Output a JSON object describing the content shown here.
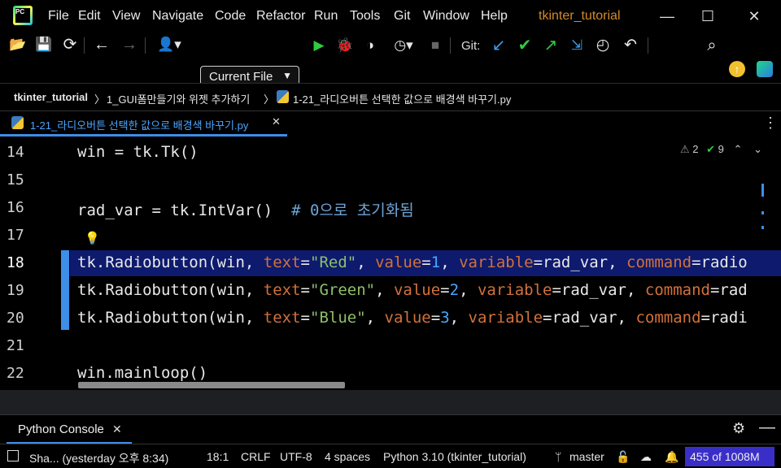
{
  "title_bar": {
    "menu": [
      "File",
      "Edit",
      "View",
      "Navigate",
      "Code",
      "Refactor",
      "Run",
      "Tools",
      "Git",
      "Window",
      "Help"
    ],
    "project": "tkinter_tutorial"
  },
  "toolbar": {
    "run_config": "Current File",
    "git_label": "Git:"
  },
  "breadcrumb": {
    "items": [
      "tkinter_tutorial",
      "1_GUI폼만들기와 위젯 추가하기",
      "1-21_라디오버튼 선택한 값으로 배경색 바꾸기.py"
    ]
  },
  "tabs": {
    "active": "1-21_라디오버튼 선택한 값으로 배경색 바꾸기.py",
    "close": "✕"
  },
  "editor": {
    "inspections": {
      "warnings": "2",
      "weak_warnings": "9"
    },
    "lines": [
      {
        "n": "14",
        "text": "win = tk.Tk()"
      },
      {
        "n": "15",
        "text": ""
      },
      {
        "n": "16",
        "text": "rad_var = tk.IntVar()  # 0으로 초기화됨"
      },
      {
        "n": "17",
        "text": ""
      },
      {
        "n": "18",
        "text": "tk.Radiobutton(win, text=\"Red\", value=1, variable=rad_var, command=radio"
      },
      {
        "n": "19",
        "text": "tk.Radiobutton(win, text=\"Green\", value=2, variable=rad_var, command=rad"
      },
      {
        "n": "20",
        "text": "tk.Radiobutton(win, text=\"Blue\", value=3, variable=rad_var, command=radi"
      },
      {
        "n": "21",
        "text": ""
      },
      {
        "n": "22",
        "text": "win.mainloop()"
      }
    ]
  },
  "console": {
    "tab": "Python Console",
    "close": "✕"
  },
  "status": {
    "vcs_message": "Sha... (yesterday 오후 8:34)",
    "position": "18:1",
    "line_sep": "CRLF",
    "encoding": "UTF-8",
    "indent": "4 spaces",
    "interpreter": "Python 3.10 (tkinter_tutorial)",
    "branch": "master",
    "memory": "455 of 1008M"
  },
  "colors": {
    "accent": "#3d8ee6",
    "project_title": "#d28a2c",
    "highlight": "#0d1a6e",
    "memory_bg": "#3a2ec9"
  }
}
